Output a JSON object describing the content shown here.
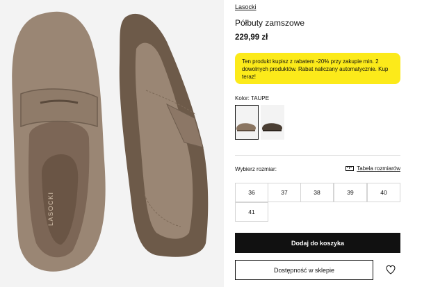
{
  "product": {
    "brand": "Lasocki",
    "name": "Półbuty zamszowe",
    "price": "229,99 zł",
    "promo": "Ten produkt kupisz z rabatem -20% przy zakupie min. 2 dowolnych produktów. Rabat naliczany automatycznie. Kup teraz!",
    "image_brand_text": "LASOCKI"
  },
  "color": {
    "label": "Kolor: TAUPE",
    "swatches": [
      {
        "name": "taupe",
        "color": "#8a7561",
        "selected": true
      },
      {
        "name": "brown",
        "color": "#4a3e33",
        "selected": false
      }
    ]
  },
  "sizes": {
    "label": "Wybierz rozmiar:",
    "table_link": "Tabela rozmiarów",
    "options": [
      "36",
      "37",
      "38",
      "39",
      "40",
      "41"
    ]
  },
  "actions": {
    "add_to_cart": "Dodaj do koszyka",
    "store_availability": "Dostępność w sklepie"
  },
  "colors": {
    "suede": "#9a8674",
    "sole": "#6d5a49",
    "promo_bg": "#fcea1a"
  },
  "icons": {
    "size_table": "ruler-icon",
    "wishlist": "heart-icon"
  }
}
